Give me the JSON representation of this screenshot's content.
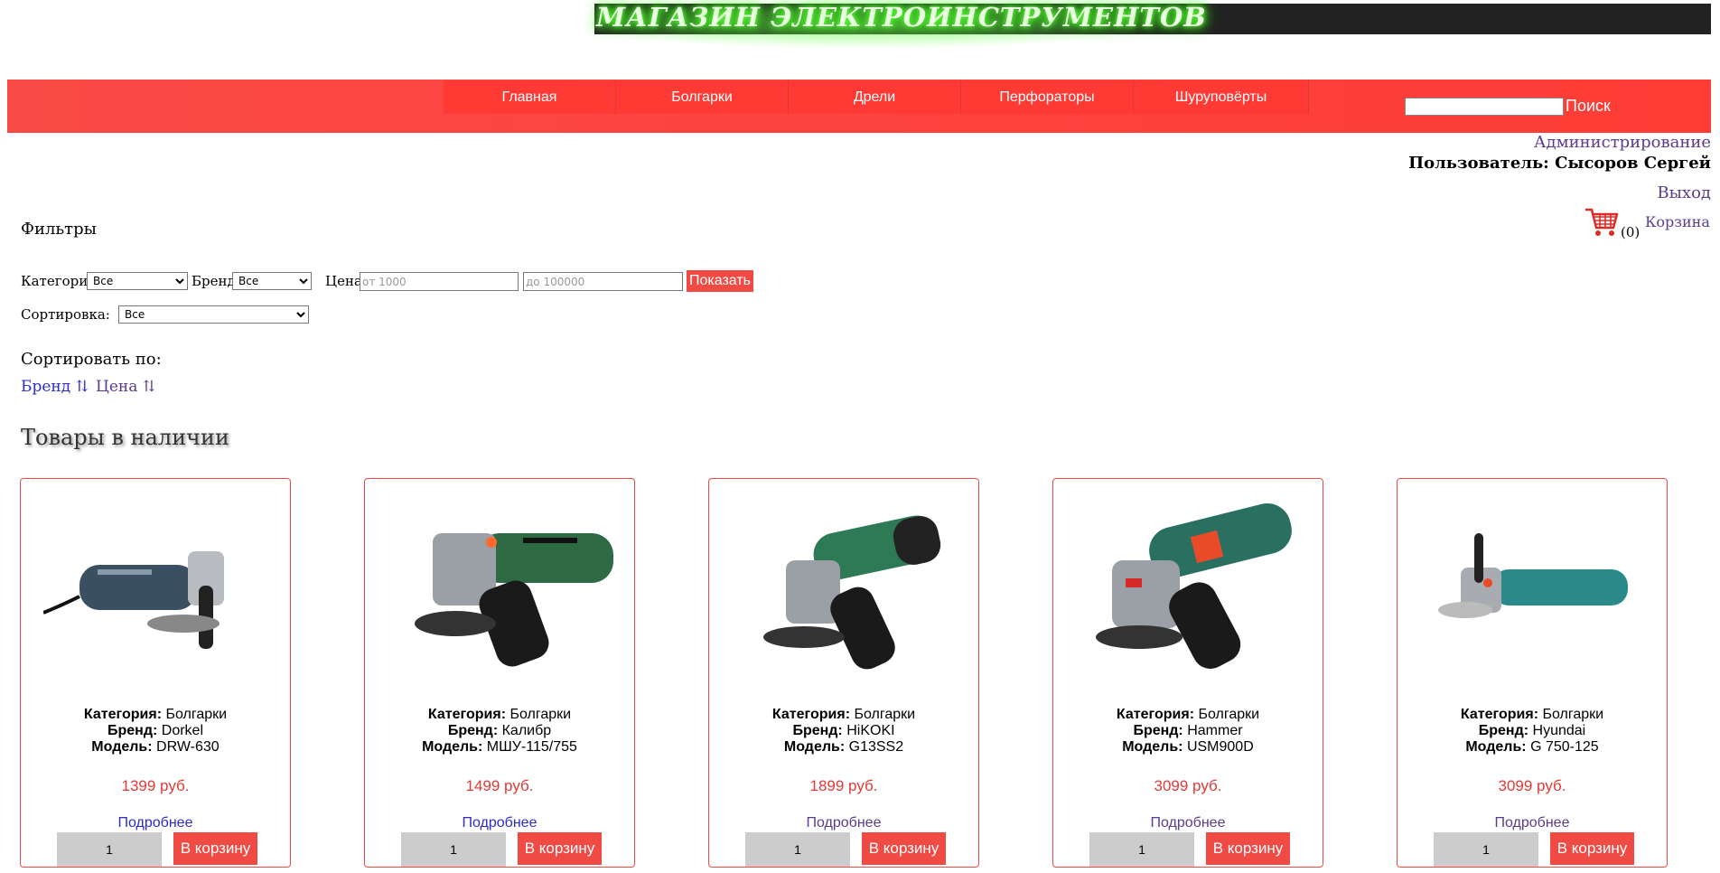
{
  "header": {
    "logo_text": "МАГАЗИН ЭЛЕКТРОИНСТРУМЕНТОВ",
    "nav": [
      "Главная",
      "Болгарки",
      "Дрели",
      "Перфораторы",
      "Шуруповёрты"
    ],
    "search": {
      "value": "",
      "button_label": "Поиск"
    },
    "colors": {
      "accent": "#f04a45",
      "logo_glow": "#66ff44"
    }
  },
  "user": {
    "admin_link": "Администрирование",
    "user_line": "Пользователь: Сысоров Сергей",
    "logout_link": "Выход",
    "cart_count": "(0)",
    "cart_link": "Корзина"
  },
  "filters": {
    "title": "Фильтры",
    "category_label": "Категория",
    "category_value": "Все",
    "brand_label": "Бренд",
    "brand_value": "Все",
    "price_label": "Цена",
    "price_from_placeholder": "от 1000",
    "price_to_placeholder": "до 100000",
    "show_button": "Показать",
    "sorting_label": "Сортировка:",
    "sorting_value": "Все"
  },
  "sort": {
    "title": "Сортировать по:",
    "brand": "Бренд ⇅",
    "price": "Цена ⇅"
  },
  "section_title": "Товары в наличии",
  "products": [
    {
      "category_label": "Категория:",
      "category": "Болгарки",
      "brand_label": "Бренд:",
      "brand": "Dorkel",
      "model_label": "Модель:",
      "model": "DRW-630",
      "price": "1399 руб.",
      "more": "Подробнее",
      "qty": "1",
      "cart": "В корзину",
      "color": "#3b4f63"
    },
    {
      "category_label": "Категория:",
      "category": "Болгарки",
      "brand_label": "Бренд:",
      "brand": "Калибр",
      "model_label": "Модель:",
      "model": "МШУ-115/755",
      "price": "1499 руб.",
      "more": "Подробнее",
      "qty": "1",
      "cart": "В корзину",
      "color": "#2e6b45"
    },
    {
      "category_label": "Категория:",
      "category": "Болгарки",
      "brand_label": "Бренд:",
      "brand": "HiKOKI",
      "model_label": "Модель:",
      "model": "G13SS2",
      "price": "1899 руб.",
      "more": "Подробнее",
      "qty": "1",
      "cart": "В корзину",
      "color": "#2e7a55"
    },
    {
      "category_label": "Категория:",
      "category": "Болгарки",
      "brand_label": "Бренд:",
      "brand": "Hammer",
      "model_label": "Модель:",
      "model": "USM900D",
      "price": "3099 руб.",
      "more": "Подробнее",
      "qty": "1",
      "cart": "В корзину",
      "color": "#2a7060"
    },
    {
      "category_label": "Категория:",
      "category": "Болгарки",
      "brand_label": "Бренд:",
      "brand": "Hyundai",
      "model_label": "Модель:",
      "model": "G 750-125",
      "price": "3099 руб.",
      "more": "Подробнее",
      "qty": "1",
      "cart": "В корзину",
      "color": "#2a8a8a"
    }
  ]
}
